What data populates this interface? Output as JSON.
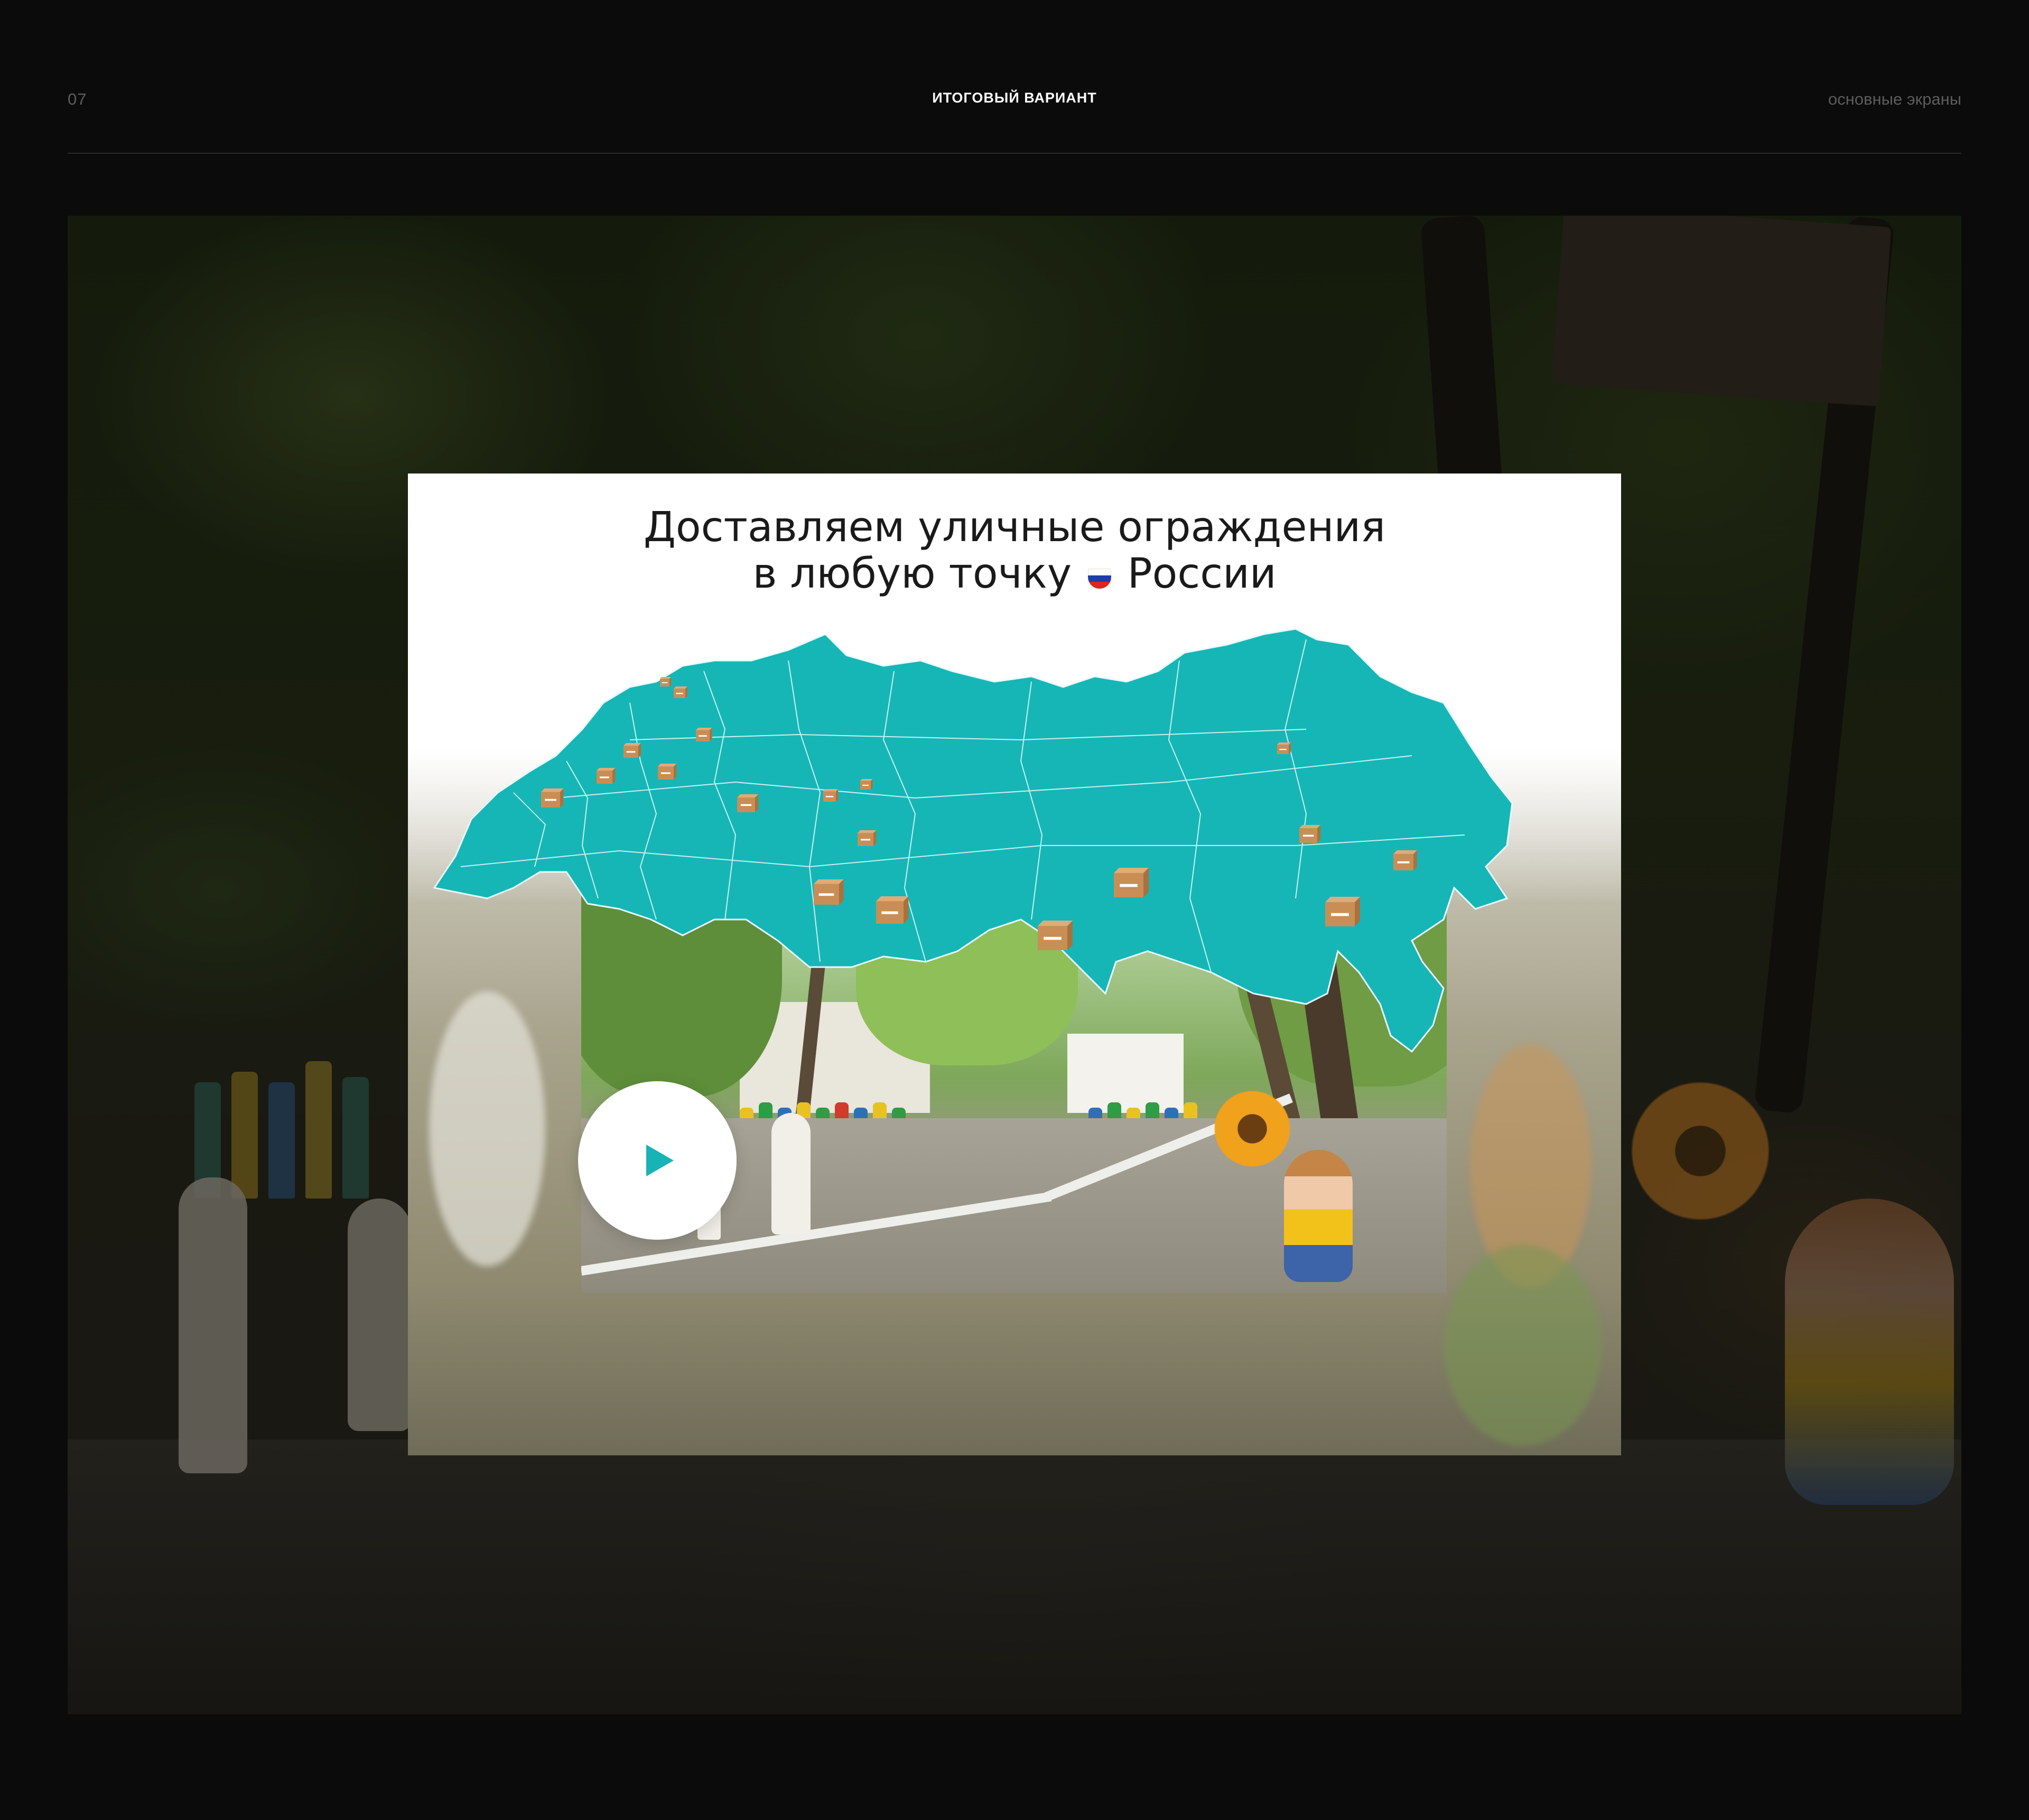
{
  "header": {
    "number": "07",
    "title": "ИТОГОВЫЙ ВАРИАНТ",
    "section": "основные экраны"
  },
  "hero": {
    "title_line1": "Доставляем уличные ограждения",
    "title_line2_before": "в любую точку",
    "title_line2_after": "России",
    "flag_colors": [
      "#ffffff",
      "#1c3fa8",
      "#d52b1e"
    ]
  },
  "map": {
    "fill_color": "#16b6b6",
    "border_color": "#e8fbfb",
    "marker": "package-box-icon"
  },
  "video": {
    "play_icon": "play-icon",
    "accent_color": "#18b3b5"
  }
}
